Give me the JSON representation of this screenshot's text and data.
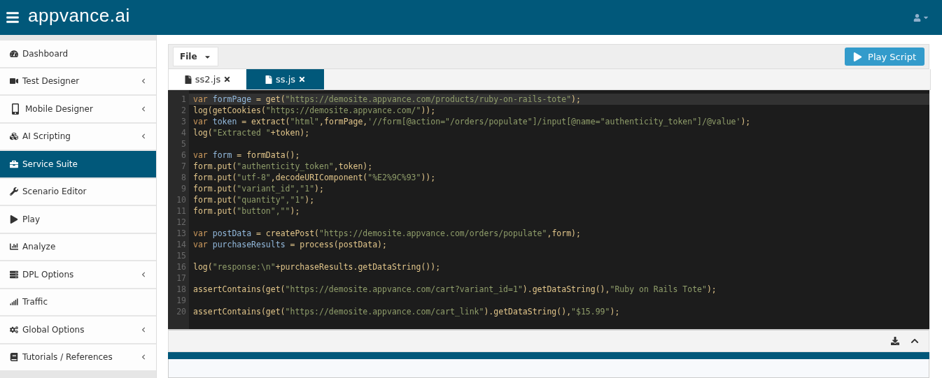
{
  "header": {
    "logo": "appvance.ai"
  },
  "sidebar": {
    "items": [
      {
        "label": "Dashboard",
        "selected": false,
        "expandable": false
      },
      {
        "label": "Test Designer",
        "selected": false,
        "expandable": true
      },
      {
        "label": "Mobile Designer",
        "selected": false,
        "expandable": true
      },
      {
        "label": "AI Scripting",
        "selected": false,
        "expandable": true
      },
      {
        "label": "Service Suite",
        "selected": true,
        "expandable": false
      },
      {
        "label": "Scenario Editor",
        "selected": false,
        "expandable": false
      },
      {
        "label": "Play",
        "selected": false,
        "expandable": false
      },
      {
        "label": "Analyze",
        "selected": false,
        "expandable": false
      },
      {
        "label": "DPL Options",
        "selected": false,
        "expandable": true
      },
      {
        "label": "Traffic",
        "selected": false,
        "expandable": false
      },
      {
        "label": "Global Options",
        "selected": false,
        "expandable": true
      },
      {
        "label": "Tutorials / References",
        "selected": false,
        "expandable": true
      }
    ]
  },
  "toolbar": {
    "file_menu": "File",
    "play_button": "Play Script"
  },
  "tabs": [
    {
      "label": "ss2.js",
      "selected": false
    },
    {
      "label": "ss.js",
      "selected": true
    }
  ],
  "editor": {
    "lines": [
      {
        "number": "1",
        "current": true,
        "tokens": [
          {
            "kind": "kw",
            "text": "var "
          },
          {
            "kind": "def",
            "text": "formPage"
          },
          {
            "kind": "code",
            "text": " = get("
          },
          {
            "kind": "str",
            "text": "\"https://demosite.appvance.com/products/ruby-on-rails-tote\""
          },
          {
            "kind": "code",
            "text": ");"
          }
        ]
      },
      {
        "number": "2",
        "current": false,
        "tokens": [
          {
            "kind": "code",
            "text": "log(getCookies("
          },
          {
            "kind": "str",
            "text": "\"https://demosite.appvance.com/\""
          },
          {
            "kind": "code",
            "text": "));"
          }
        ]
      },
      {
        "number": "3",
        "current": false,
        "tokens": [
          {
            "kind": "kw",
            "text": "var "
          },
          {
            "kind": "def",
            "text": "token"
          },
          {
            "kind": "code",
            "text": " = extract("
          },
          {
            "kind": "str",
            "text": "\"html\""
          },
          {
            "kind": "code",
            "text": ",formPage,"
          },
          {
            "kind": "str",
            "text": "'//form[@action=\"/orders/populate\"]/input[@name=\"authenticity_token\"]/@value'"
          },
          {
            "kind": "code",
            "text": ");"
          }
        ]
      },
      {
        "number": "4",
        "current": false,
        "tokens": [
          {
            "kind": "code",
            "text": "log("
          },
          {
            "kind": "str",
            "text": "\"Extracted \""
          },
          {
            "kind": "code",
            "text": "+token);"
          }
        ]
      },
      {
        "number": "5",
        "current": false
      },
      {
        "number": "6",
        "current": false,
        "tokens": [
          {
            "kind": "kw",
            "text": "var "
          },
          {
            "kind": "def",
            "text": "form"
          },
          {
            "kind": "code",
            "text": " = formData();"
          }
        ]
      },
      {
        "number": "7",
        "current": false,
        "tokens": [
          {
            "kind": "code",
            "text": "form.put("
          },
          {
            "kind": "str",
            "text": "\"authenticity_token\""
          },
          {
            "kind": "code",
            "text": ",token);"
          }
        ]
      },
      {
        "number": "8",
        "current": false,
        "tokens": [
          {
            "kind": "code",
            "text": "form.put("
          },
          {
            "kind": "str",
            "text": "\"utf-8\""
          },
          {
            "kind": "code",
            "text": ",decodeURIComponent("
          },
          {
            "kind": "str",
            "text": "\"%E2%9C%93\""
          },
          {
            "kind": "code",
            "text": "));"
          }
        ]
      },
      {
        "number": "9",
        "current": false,
        "tokens": [
          {
            "kind": "code",
            "text": "form.put("
          },
          {
            "kind": "str",
            "text": "\"variant_id\",\"1\""
          },
          {
            "kind": "code",
            "text": ");"
          }
        ]
      },
      {
        "number": "10",
        "current": false,
        "tokens": [
          {
            "kind": "code",
            "text": "form.put("
          },
          {
            "kind": "str",
            "text": "\"quantity\",\"1\""
          },
          {
            "kind": "code",
            "text": ");"
          }
        ]
      },
      {
        "number": "11",
        "current": false,
        "tokens": [
          {
            "kind": "code",
            "text": "form.put("
          },
          {
            "kind": "str",
            "text": "\"button\",\"\""
          },
          {
            "kind": "code",
            "text": ");"
          }
        ]
      },
      {
        "number": "12",
        "current": false
      },
      {
        "number": "13",
        "current": false,
        "tokens": [
          {
            "kind": "kw",
            "text": "var "
          },
          {
            "kind": "def",
            "text": "postData"
          },
          {
            "kind": "code",
            "text": " = createPost("
          },
          {
            "kind": "str",
            "text": "\"https://demosite.appvance.com/orders/populate\""
          },
          {
            "kind": "code",
            "text": ",form);"
          }
        ]
      },
      {
        "number": "14",
        "current": false,
        "tokens": [
          {
            "kind": "kw",
            "text": "var "
          },
          {
            "kind": "def",
            "text": "purchaseResults"
          },
          {
            "kind": "code",
            "text": " = process(postData);"
          }
        ]
      },
      {
        "number": "15",
        "current": false
      },
      {
        "number": "16",
        "current": false,
        "tokens": [
          {
            "kind": "code",
            "text": "log("
          },
          {
            "kind": "str",
            "text": "\"response:\\n\""
          },
          {
            "kind": "code",
            "text": "+purchaseResults.getDataString());"
          }
        ]
      },
      {
        "number": "17",
        "current": false
      },
      {
        "number": "18",
        "current": false,
        "tokens": [
          {
            "kind": "code",
            "text": "assertContains(get("
          },
          {
            "kind": "str",
            "text": "\"https://demosite.appvance.com/cart?variant_id=1\""
          },
          {
            "kind": "code",
            "text": ").getDataString(),"
          },
          {
            "kind": "str",
            "text": "\"Ruby on Rails Tote\""
          },
          {
            "kind": "code",
            "text": ");"
          }
        ]
      },
      {
        "number": "19",
        "current": false
      },
      {
        "number": "20",
        "current": false,
        "tokens": [
          {
            "kind": "code",
            "text": "assertContains(get("
          },
          {
            "kind": "str",
            "text": "\"https://demosite.appvance.com/cart_link\""
          },
          {
            "kind": "code",
            "text": ").getDataString(),"
          },
          {
            "kind": "str",
            "text": "\"$15.99\""
          },
          {
            "kind": "code",
            "text": ");"
          }
        ]
      }
    ]
  }
}
